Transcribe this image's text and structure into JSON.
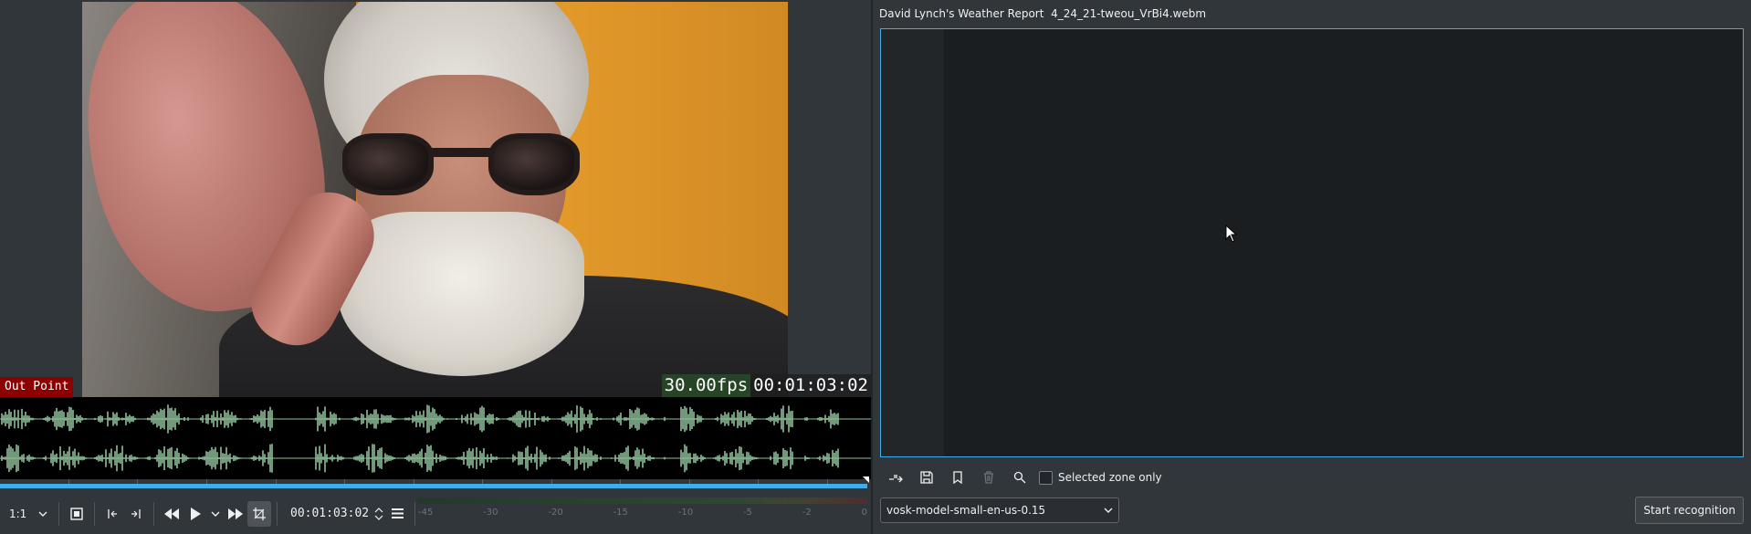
{
  "monitor": {
    "overlay": {
      "out_point_label": "Out Point",
      "fps": "30.00fps",
      "timecode": "00:01:03:02"
    },
    "waveform_color": "#8fbf9a",
    "transport": {
      "zoom": "1:1",
      "timecode": "00:01:03:02",
      "icons": [
        "zoom-dropdown-icon",
        "fit-frame-icon",
        "set-in-icon",
        "set-out-icon",
        "rewind-icon",
        "play-icon",
        "play-options-icon",
        "forward-icon",
        "crop-icon",
        "timecode-spin-icon",
        "menu-icon"
      ]
    },
    "vu_labels": [
      "-45",
      "-30",
      "-20",
      "-15",
      "-10",
      "-5",
      "-2",
      "0"
    ]
  },
  "speech": {
    "title": "David Lynch's Weather Report  4_24_21-tweou_VrBi4.webm",
    "toolbar": {
      "icons": [
        "insert-clip-icon",
        "save-icon",
        "bookmark-icon",
        "delete-icon",
        "search-icon"
      ],
      "selected_zone_label": "Selected zone only"
    },
    "model": "vosk-model-small-en-us-0.15",
    "start_button": "Start recognition"
  },
  "colors": {
    "accent": "#3daee9",
    "background": "#31363b",
    "editor_bg": "#1b1e20",
    "out_point_bg": "#8b0000"
  }
}
